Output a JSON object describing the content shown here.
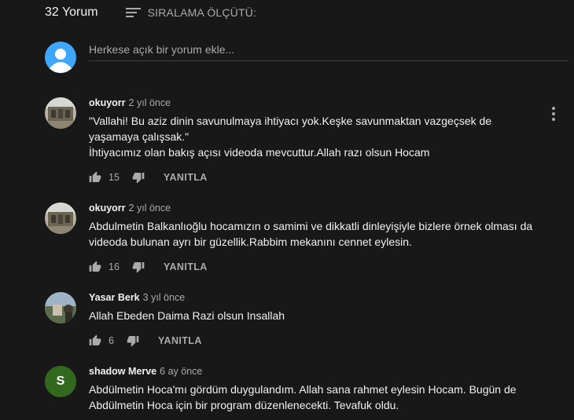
{
  "header": {
    "count_label": "32 Yorum",
    "sort_label": "SIRALAMA ÖLÇÜTÜ:"
  },
  "add_comment": {
    "placeholder": "Herkese açık bir yorum ekle..."
  },
  "comments": [
    {
      "author": "okuyorr",
      "time": "2 yıl önce",
      "text": "\"Vallahi! Bu aziz dinin savunulmaya ihtiyacı yok.Keşke savunmaktan vazgeçsek de\nyaşamaya çalışsak.\"\nİhtiyacımız olan bakış açısı videoda mevcuttur.Allah razı olsun Hocam",
      "likes": "15",
      "reply_label": "YANITLA"
    },
    {
      "author": "okuyorr",
      "time": "2 yıl önce",
      "text": "Abdulmetin Balkanlıoğlu hocamızın o samimi ve dikkatli dinleyişiyle bizlere örnek olması da\nvideoda bulunan ayrı bir güzellik.Rabbim mekanını cennet eylesin.",
      "likes": "16",
      "reply_label": "YANITLA"
    },
    {
      "author": "Yasar Berk",
      "time": "3 yıl önce",
      "text": "Allah Ebeden Daima Razi olsun Insallah",
      "likes": "6",
      "reply_label": "YANITLA"
    },
    {
      "author": "shadow Merve",
      "time": "6 ay önce",
      "avatar_letter": "S",
      "avatar_color": "#33691e",
      "text": "Abdülmetin Hoca'mı gördüm duygulandım. Allah sana rahmet eylesin Hocam. Bugün de\nAbdülmetin Hoca için bir program düzenlenecekti. Tevafuk oldu."
    }
  ],
  "colors": {
    "background": "#181818",
    "text": "#f1f1f1",
    "secondary": "#aaaaaa",
    "user_avatar": "#3ea6ff"
  }
}
